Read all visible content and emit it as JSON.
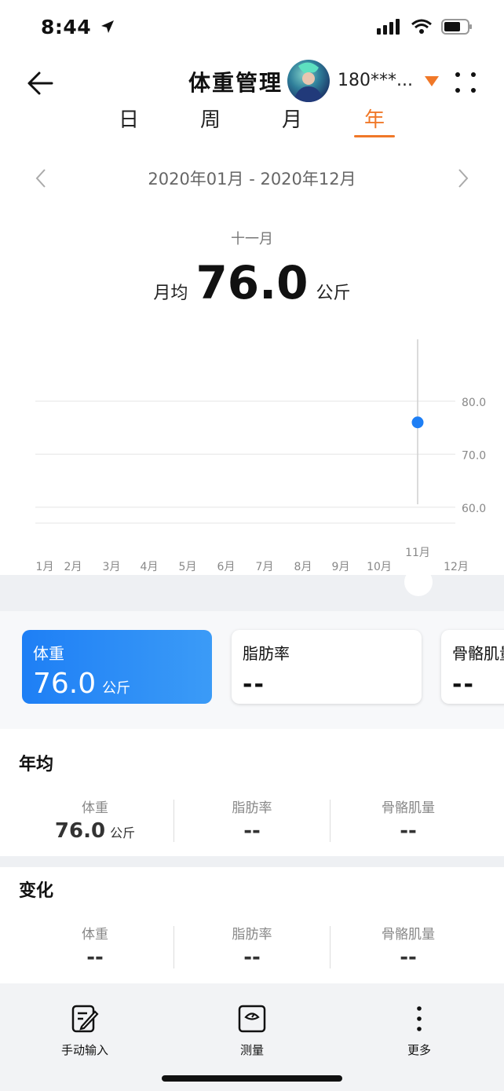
{
  "status_bar": {
    "time": "8:44",
    "icons": [
      "location-arrow-icon",
      "signal-icon",
      "wifi-icon",
      "battery-icon"
    ]
  },
  "header": {
    "title": "体重管理",
    "account": "180***...",
    "icons": [
      "back-arrow-icon",
      "dropdown-triangle-icon",
      "more-dots-icon"
    ]
  },
  "tabs": [
    {
      "label": "日",
      "active": false
    },
    {
      "label": "周",
      "active": false
    },
    {
      "label": "月",
      "active": false
    },
    {
      "label": "年",
      "active": true
    }
  ],
  "range": {
    "text": "2020年01月 - 2020年12月"
  },
  "summary": {
    "month": "十一月",
    "prefix": "月均",
    "value": "76.0",
    "unit": "公斤"
  },
  "chart_data": {
    "type": "scatter",
    "categories": [
      "1月",
      "2月",
      "3月",
      "4月",
      "5月",
      "6月",
      "7月",
      "8月",
      "9月",
      "10月",
      "11月",
      "12月"
    ],
    "values": [
      null,
      null,
      null,
      null,
      null,
      null,
      null,
      null,
      null,
      null,
      76.0,
      null
    ],
    "y_ticks": [
      "80.0",
      "70.0",
      "60.0"
    ],
    "ylim": [
      57,
      85
    ],
    "grid": true,
    "selected_category": "11月",
    "accent": "#1e7ff5"
  },
  "cards": [
    {
      "label": "体重",
      "value": "76.0",
      "unit": "公斤",
      "active": true
    },
    {
      "label": "脂肪率",
      "value": "--",
      "active": false
    },
    {
      "label": "骨骼肌量",
      "value": "--",
      "active": false
    }
  ],
  "yearly_avg": {
    "title": "年均",
    "stats": [
      {
        "label": "体重",
        "value": "76.0",
        "unit": "公斤"
      },
      {
        "label": "脂肪率",
        "value": "--"
      },
      {
        "label": "骨骼肌量",
        "value": "--"
      }
    ]
  },
  "change": {
    "title": "变化",
    "stats": [
      {
        "label": "体重",
        "value": "--"
      },
      {
        "label": "脂肪率",
        "value": "--"
      },
      {
        "label": "骨骼肌量",
        "value": "--"
      }
    ]
  },
  "bottom_bar": [
    {
      "label": "手动输入",
      "icon": "manual-input-icon"
    },
    {
      "label": "测量",
      "icon": "scale-measure-icon"
    },
    {
      "label": "更多",
      "icon": "more-vertical-icon"
    }
  ],
  "colors": {
    "accent_orange": "#f07828",
    "accent_blue": "#1e7ff5"
  }
}
